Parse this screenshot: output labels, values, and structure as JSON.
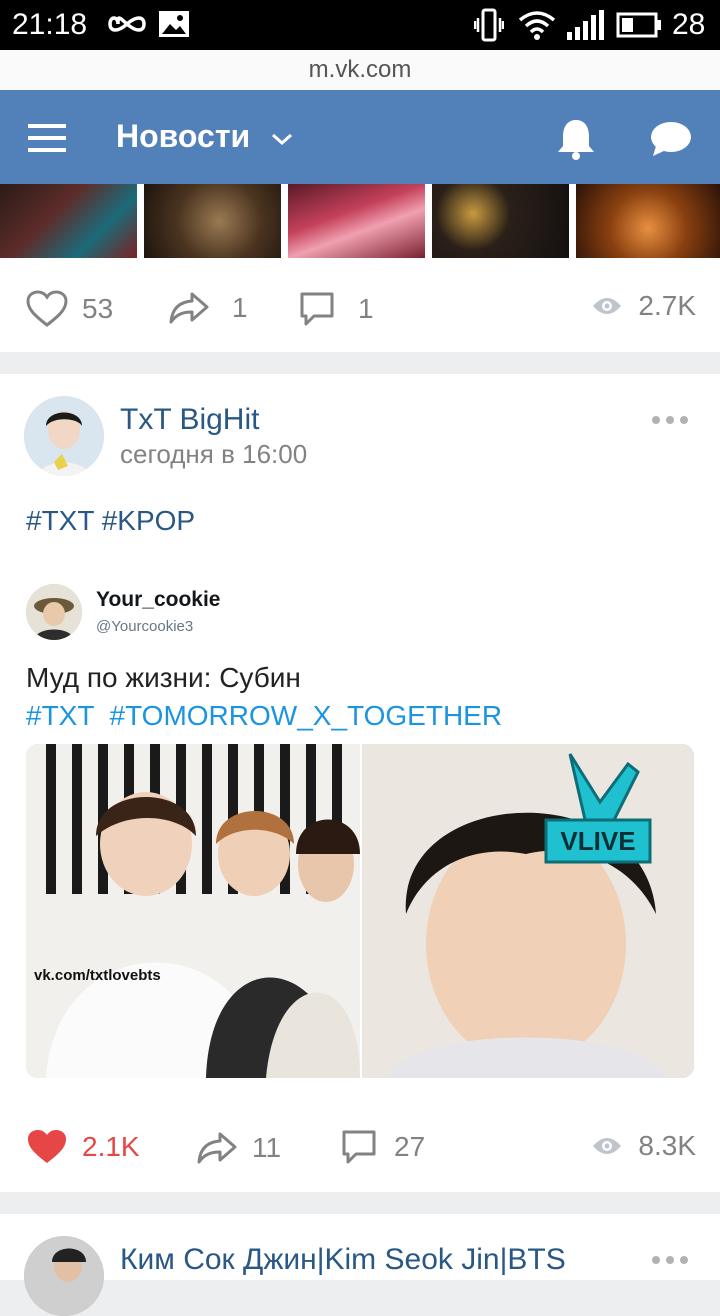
{
  "status_bar": {
    "time": "21:18",
    "battery": "28"
  },
  "browser": {
    "url": "m.vk.com"
  },
  "header": {
    "title": "Новости"
  },
  "post1": {
    "likes": "53",
    "shares": "1",
    "comments": "1",
    "views": "2.7K"
  },
  "post2": {
    "author": "TxT BigHit",
    "date": "сегодня в 16:00",
    "hashtags": "#TXT #KPOP",
    "tweet": {
      "name": "Your_cookie",
      "handle": "@Yourcookie3",
      "text": "Муд по жизни: Субин",
      "tags": "#TXT  #TOMORROW_X_TOGETHER"
    },
    "image_watermark": "vk.com/txtlovebts",
    "image_badge": "VLIVE",
    "likes": "2.1K",
    "shares": "11",
    "comments": "27",
    "views": "8.3K"
  },
  "post3": {
    "author": "Ким Сок Джин|Kim Seok Jin|BTS"
  },
  "colors": {
    "accent": "#5181b8",
    "link": "#2a5885",
    "like_active": "#e64646",
    "muted": "#828282"
  }
}
